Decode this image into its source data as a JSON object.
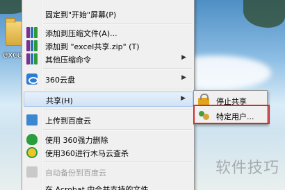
{
  "desktop": {
    "folder_label": "exce"
  },
  "menu": {
    "top_partial": "",
    "pin_start": "固定到\"开始\"屏幕(P)",
    "add_archive": "添加到压缩文件(A)...",
    "add_zip": "添加到 \"excel共享.zip\" (T)",
    "other_compress": "其他压缩命令",
    "cloud_360": "360云盘",
    "share": "共享(H)",
    "upload_baidu": "上传到百度云",
    "delete_360": "使用 360强力删除",
    "scan_360": "使用360进行木马云查杀",
    "auto_backup_baidu": "自动备份到百度云",
    "bottom_partial": "在 Acrobat 中合并支持的文件"
  },
  "submenu": {
    "stop_share": "停止共享",
    "specific_users": "特定用户..."
  },
  "watermark": "软件技巧",
  "colors": {
    "highlight_border": "#d42a2a",
    "menu_bg": "#f0f0f0"
  }
}
